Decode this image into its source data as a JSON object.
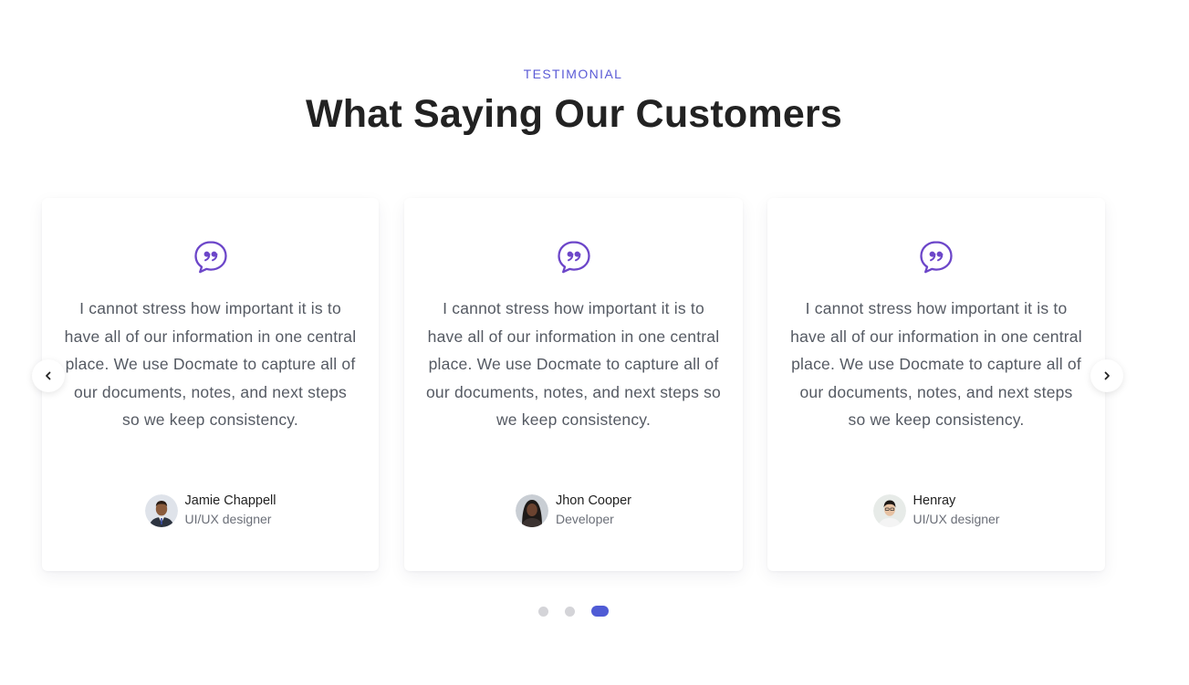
{
  "section": {
    "eyebrow": "TESTIMONIAL",
    "heading": "What Saying Our Customers"
  },
  "colors": {
    "accent": "#5b5bd6",
    "quote_icon": "#6c46c9",
    "active_dot": "#4f5bd5",
    "inactive_dot": "#d4d4d8"
  },
  "testimonials": [
    {
      "quote": "I cannot stress how important it is to have all of our information in one central place. We use Docmate to capture all of our documents, notes, and next steps so we keep consistency.",
      "name": "Jamie Chappell",
      "role": "UI/UX designer",
      "icon": "quote-icon"
    },
    {
      "quote": "I cannot stress how important it is to have all of our information in one central place. We use Docmate to capture all of our documents, notes, and next steps so we keep consistency.",
      "name": "Jhon Cooper",
      "role": "Developer",
      "icon": "quote-icon"
    },
    {
      "quote": "I cannot stress how important it is to have all of our information in one central place. We use Docmate to capture all of our documents, notes, and next steps so we keep consistency.",
      "name": "Henray",
      "role": "UI/UX designer",
      "icon": "quote-icon"
    }
  ],
  "carousel": {
    "prev_icon": "chevron-left-icon",
    "next_icon": "chevron-right-icon",
    "pages": 3,
    "active_page": 3
  }
}
